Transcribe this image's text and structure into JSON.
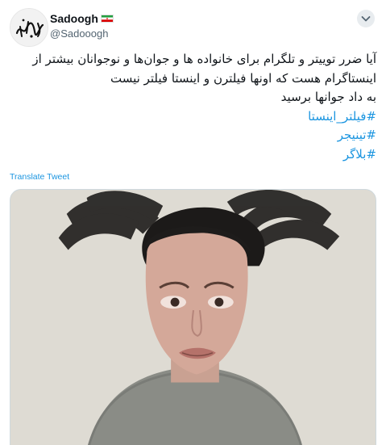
{
  "author": {
    "display_name": "Sadoogh",
    "handle": "@Sadooogh",
    "avatar_icon": "calligraphy-signature-avatar",
    "flag_icon": "iran-flag-emoji"
  },
  "tweet": {
    "lines": [
      "آیا ضرر توییتر و تلگرام برای خانواده ها و جوان‌ها و نوجوانان بیشتر از",
      "اینستاگرام هست که اونها فیلترن و اینستا فیلتر نیست",
      "به داد جوانها برسید"
    ],
    "hashtags": [
      "#فیلتر_اینستا",
      "#تینیجر",
      "#بلاگر"
    ]
  },
  "actions": {
    "translate_label": "Translate Tweet",
    "more_icon": "chevron-down-icon"
  },
  "media": {
    "type": "video-thumbnail",
    "subject_icon": "person-video-frame"
  },
  "colors": {
    "accent": "#1b95e0",
    "text": "#0f1419",
    "secondary": "#536471"
  }
}
